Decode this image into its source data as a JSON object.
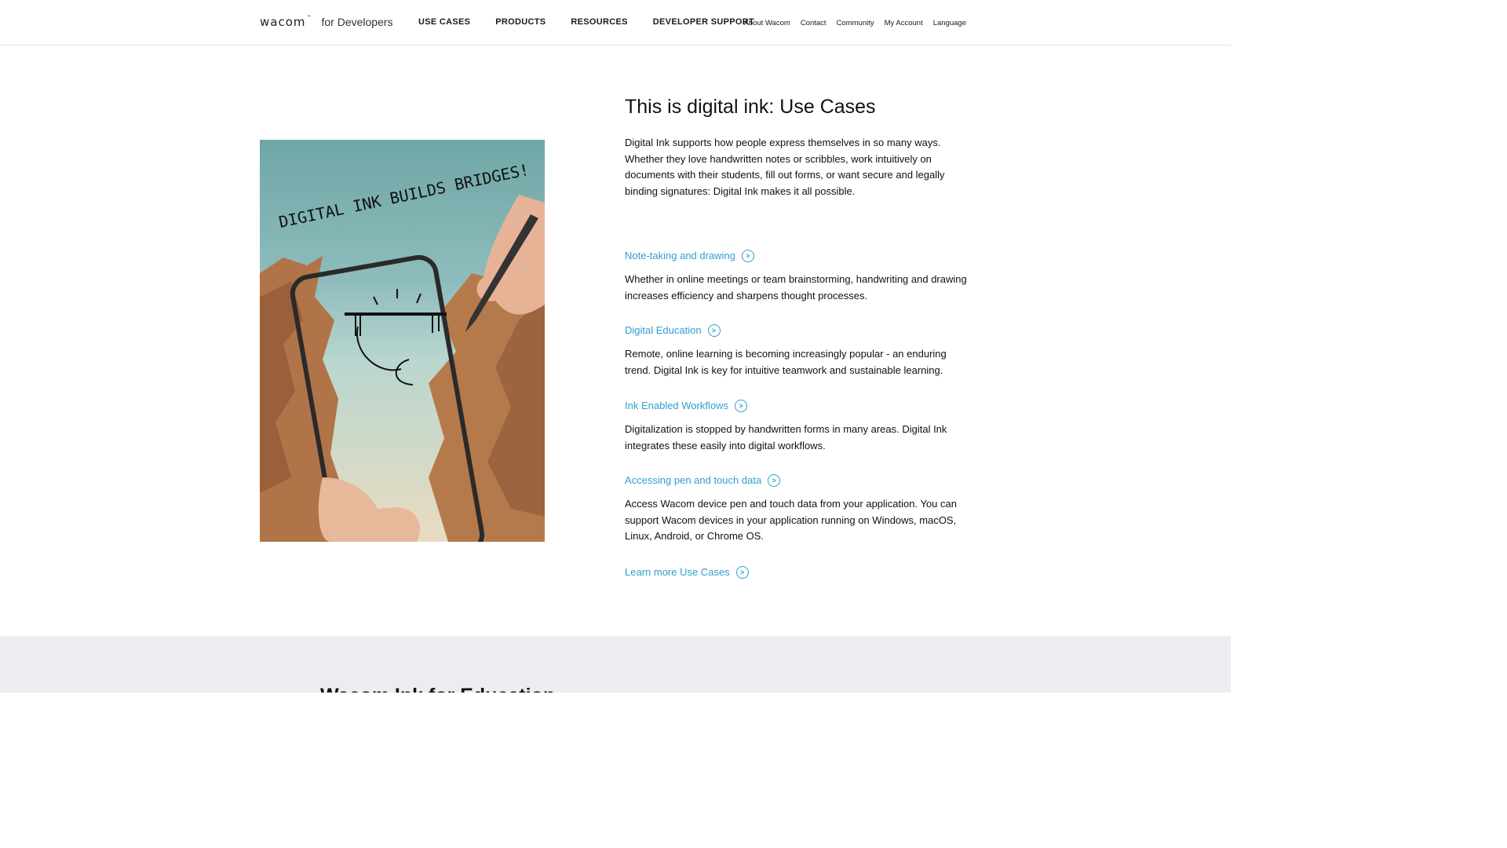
{
  "header": {
    "logo_mark": "wacom",
    "logo_sub": "for Developers",
    "main_nav": [
      {
        "label": "USE CASES"
      },
      {
        "label": "PRODUCTS"
      },
      {
        "label": "RESOURCES"
      },
      {
        "label": "DEVELOPER SUPPORT"
      }
    ],
    "util_nav": [
      {
        "label": "About Wacom"
      },
      {
        "label": "Contact"
      },
      {
        "label": "Community"
      },
      {
        "label": "My Account"
      },
      {
        "label": "Language"
      }
    ]
  },
  "hero_image": {
    "handwriting": "DIGITAL INK BUILDS BRIDGES!"
  },
  "main": {
    "title": "This is digital ink: Use Cases",
    "intro": "Digital Ink supports how people express themselves in so many ways. Whether they love handwritten notes or scribbles, work intuitively on documents with their students, fill out forms, or want secure and legally binding signatures: Digital Ink makes it all possible.",
    "use_cases": [
      {
        "link": "Note-taking and drawing",
        "desc": "Whether in online meetings or team brainstorming, handwriting and drawing increases efficiency and sharpens thought processes."
      },
      {
        "link": "Digital Education",
        "desc": "Remote, online learning is becoming increasingly popular - an enduring trend. Digital Ink is key for intuitive teamwork and sustainable learning."
      },
      {
        "link": "Ink Enabled Workflows",
        "desc": "Digitalization is stopped by handwritten forms in many areas. Digital Ink integrates these easily into digital workflows."
      },
      {
        "link": "Accessing pen and touch data",
        "desc": "Access Wacom device pen and touch data from your application. You can support Wacom devices in your application running on Windows, macOS, Linux, Android, or Chrome OS."
      }
    ],
    "learn_more": "Learn more Use Cases"
  },
  "band": {
    "title": "Wacom Ink for Education"
  },
  "colors": {
    "link": "#2f9fd0",
    "band_bg": "#ecedf1"
  },
  "icons": [
    "chevron-right-circle-icon"
  ]
}
